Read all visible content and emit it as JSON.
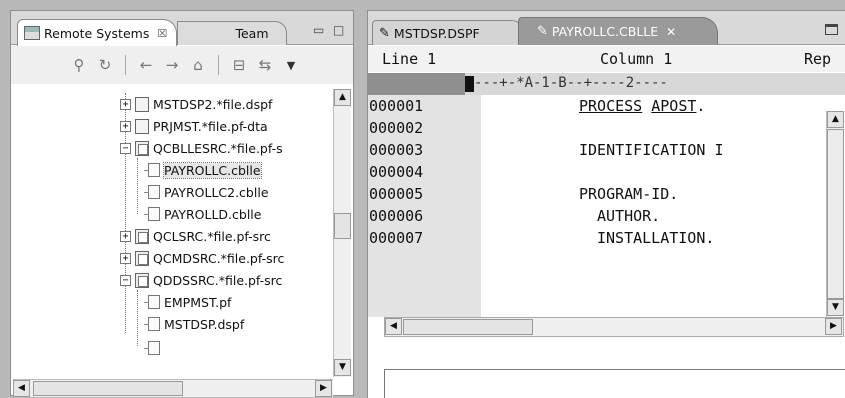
{
  "left_view": {
    "tab_active_label": "Remote Systems",
    "tab_active_close": "☒",
    "tab_inactive_label": "Team",
    "controls": {
      "minimize": "▭",
      "maximize": "□"
    },
    "toolbar_icons": [
      "connect-icon",
      "refresh-icon",
      "back-icon",
      "forward-icon",
      "home-icon",
      "collapse-all-icon",
      "link-with-editor-icon",
      "view-menu-icon"
    ],
    "tree": [
      {
        "label": "MSTDSP2.*file.dspf",
        "expander": "+",
        "icon": "display-file-icon"
      },
      {
        "label": "PRJMST.*file.pf-dta",
        "expander": "+",
        "icon": "data-file-icon"
      },
      {
        "label": "QCBLLESRC.*file.pf-s",
        "expander": "−",
        "icon": "source-file-icon"
      },
      {
        "label": "PAYROLLC.cblle",
        "expander": "",
        "icon": "member-icon",
        "selected": true
      },
      {
        "label": "PAYROLLC2.cblle",
        "expander": "",
        "icon": "member-icon"
      },
      {
        "label": "PAYROLLD.cblle",
        "expander": "",
        "icon": "member-icon"
      },
      {
        "label": "QCLSRC.*file.pf-src",
        "expander": "+",
        "icon": "source-file-icon"
      },
      {
        "label": "QCMDSRC.*file.pf-src",
        "expander": "+",
        "icon": "source-file-icon"
      },
      {
        "label": "QDDSSRC.*file.pf-src",
        "expander": "−",
        "icon": "source-file-icon"
      },
      {
        "label": "EMPMST.pf",
        "expander": "",
        "icon": "member-icon"
      },
      {
        "label": "MSTDSP.dspf",
        "expander": "",
        "icon": "member-icon"
      }
    ]
  },
  "editor": {
    "tabs": [
      {
        "label": "MSTDSP.DSPF",
        "active": false
      },
      {
        "label": "PAYROLLC.CBLLE",
        "active": true,
        "close": "✕"
      }
    ],
    "status": {
      "line_label": "Line 1",
      "column_label": "Column 1",
      "replace_label": "Rep"
    },
    "ruler": "---+-*A-1-B--+----2----",
    "lines": [
      {
        "seq": "000001",
        "text": "PROCESS APOST."
      },
      {
        "seq": "000002",
        "text": ""
      },
      {
        "seq": "000003",
        "text": "IDENTIFICATION I"
      },
      {
        "seq": "000004",
        "text": ""
      },
      {
        "seq": "000005",
        "text": "PROGRAM-ID."
      },
      {
        "seq": "000006",
        "text": "AUTHOR."
      },
      {
        "seq": "000007",
        "text": "INSTALLATION."
      }
    ]
  },
  "colors": {
    "background": "#b9b9b9",
    "active_tab": "#9a9a9a",
    "sequence_area": "#e3e3e3",
    "ruler": "#d8d8d8"
  }
}
